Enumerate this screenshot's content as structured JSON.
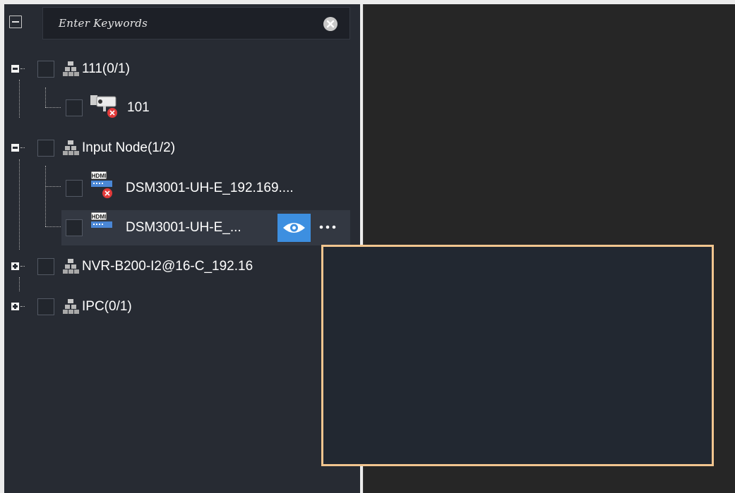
{
  "search": {
    "placeholder": "Enter Keywords",
    "clear_icon": "clear-circle-icon"
  },
  "toolbar": {
    "collapse_icon": "collapse-all-icon"
  },
  "tree": {
    "groups": [
      {
        "label": "111(0/1)",
        "icon": "device-group-icon",
        "expanded": true,
        "children": [
          {
            "label": "101",
            "icon": "camera-offline-icon"
          }
        ]
      },
      {
        "label": "Input Node(1/2)",
        "icon": "device-group-icon",
        "expanded": true,
        "children": [
          {
            "label": "DSM3001-UH-E_192.169....",
            "icon": "hdmi-offline-icon"
          },
          {
            "label": "DSM3001-UH-E_...",
            "icon": "hdmi-device-icon",
            "selected": true
          }
        ]
      },
      {
        "label": "NVR-B200-I2@16-C_192.16",
        "icon": "device-group-icon",
        "expanded": false,
        "children": []
      },
      {
        "label": "IPC(0/1)",
        "icon": "device-group-icon",
        "expanded": false,
        "children": []
      }
    ],
    "row_actions": {
      "preview_icon": "eye-icon",
      "more_icon": "more-dots-icon"
    }
  },
  "colors": {
    "panel_bg": "#272b33",
    "accent_blue": "#3d8fe0",
    "popup_border": "#f1c58f",
    "offline_red": "#e23a3a"
  }
}
